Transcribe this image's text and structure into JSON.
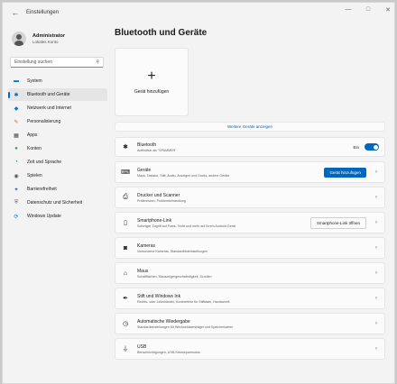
{
  "window": {
    "title": "Einstellungen",
    "back_glyph": "←",
    "controls": [
      "—",
      "□",
      "✕"
    ]
  },
  "profile": {
    "name": "Administrator",
    "account": "Lokales Konto"
  },
  "search": {
    "placeholder": "Einstellung suchen",
    "icon": "search-icon"
  },
  "nav": {
    "items": [
      {
        "label": "System",
        "icon": "system-icon",
        "glyph": "▬",
        "color": "#0078d4"
      },
      {
        "label": "Bluetooth und Geräte",
        "icon": "bluetooth-icon",
        "glyph": "✱",
        "color": "#0067c0",
        "active": true
      },
      {
        "label": "Netzwerk und Internet",
        "icon": "network-icon",
        "glyph": "◆",
        "color": "#0078d4"
      },
      {
        "label": "Personalisierung",
        "icon": "brush-icon",
        "glyph": "✎",
        "color": "#c56a2c"
      },
      {
        "label": "Apps",
        "icon": "apps-icon",
        "glyph": "▦",
        "color": "#454545"
      },
      {
        "label": "Konten",
        "icon": "accounts-icon",
        "glyph": "●",
        "color": "#2aa14f"
      },
      {
        "label": "Zeit und Sprache",
        "icon": "time-language-icon",
        "glyph": "◔",
        "color": "#0078d4"
      },
      {
        "label": "Spielen",
        "icon": "gaming-icon",
        "glyph": "◉",
        "color": "#555555"
      },
      {
        "label": "Barrierefreiheit",
        "icon": "accessibility-icon",
        "glyph": "✦",
        "color": "#1d6fbf"
      },
      {
        "label": "Datenschutz und Sicherheit",
        "icon": "shield-icon",
        "glyph": "⛨",
        "color": "#6b6b6b"
      },
      {
        "label": "Windows Update",
        "icon": "windows-update-icon",
        "glyph": "⟳",
        "color": "#0078d4"
      }
    ]
  },
  "main": {
    "page_title": "Bluetooth und Geräte",
    "add_tile": {
      "plus": "+",
      "label": "Gerät hinzufügen"
    },
    "more_link": "Weitere Geräte anzeigen",
    "bluetooth": {
      "title": "Bluetooth",
      "subtitle": "Auffindbar als \"SPAMMER\"",
      "state_label": "Ein",
      "icon": "bluetooth-icon",
      "glyph": "✱"
    },
    "rows": [
      {
        "title": "Geräte",
        "subtitle": "Maus, Tastatur, Stift, Audio, Anzeigen und Docks, andere Geräte",
        "icon": "devices-icon",
        "glyph": "⌨",
        "button": "Gerät hinzufügen",
        "button_style": "primary"
      },
      {
        "title": "Drucker und Scanner",
        "subtitle": "Präferenzen, Problembehandlung",
        "icon": "printer-icon",
        "glyph": "⎙"
      },
      {
        "title": "Smartphone-Link",
        "subtitle": "Sofortiger Zugriff auf Fotos, Texte und mehr auf Ihrem Android-Gerät",
        "icon": "phone-icon",
        "glyph": "▯",
        "button": "Smartphone-Link öffnen",
        "button_style": "secondary"
      },
      {
        "title": "Kameras",
        "subtitle": "Verbundene Kameras, Standardbildeinstellungen",
        "icon": "camera-icon",
        "glyph": "◙"
      },
      {
        "title": "Maus",
        "subtitle": "Schaltflächen, Mauszeigergeschwindigkeit, Scrollen",
        "icon": "mouse-icon",
        "glyph": "⌂"
      },
      {
        "title": "Stift und Windows Ink",
        "subtitle": "Rechts- oder Linkshänder, Kurzbefehle für Stifttaste, Handschrift",
        "icon": "pen-icon",
        "glyph": "✒"
      },
      {
        "title": "Automatische Wiedergabe",
        "subtitle": "Standardeinstellungen für Wechseldatenträger und Speicherkarten",
        "icon": "autoplay-icon",
        "glyph": "◷"
      },
      {
        "title": "USB",
        "subtitle": "Benachrichtigungen, USB-Stromsparmodus",
        "icon": "usb-icon",
        "glyph": "⏚"
      }
    ],
    "chevron": "›"
  }
}
